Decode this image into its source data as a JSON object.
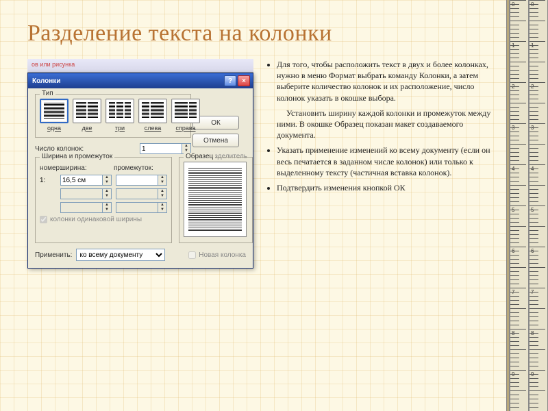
{
  "slide": {
    "title": "Разделение текста на колонки",
    "bullets": [
      "Для того, чтобы расположить текст в двух и более колонках, нужно в меню Формат выбрать команду Колонки, а затем выберите количество колонок и их расположение, число колонок указать в окошке выбора.",
      "Установить ширину каждой колонки и промежуток между ними. В окошке Образец показан макет создаваемого документа.",
      "Указать применение изменений ко всему документу (если он весь печатается в заданном числе колонок) или только к выделенному тексту (частичная вставка колонок).",
      "Подтвердить изменения кнопкой ОК"
    ],
    "toolbar_hint": "ов или рисунка"
  },
  "dialog": {
    "title": "Колонки",
    "buttons": {
      "ok": "ОК",
      "cancel": "Отмена"
    },
    "type": {
      "label": "Тип",
      "opts": [
        "одна",
        "две",
        "три",
        "слева",
        "справа"
      ],
      "selected": 0
    },
    "numcols": {
      "label": "Число колонок:",
      "value": "1"
    },
    "separator": {
      "label": "Разделитель",
      "checked": false
    },
    "width_group": {
      "label": "Ширина и промежуток",
      "cols": {
        "num": "номер:",
        "width": "ширина:",
        "gap": "промежуток:"
      },
      "rows": [
        {
          "n": "1:",
          "w": "16,5 см",
          "g": ""
        }
      ],
      "equal": {
        "label": "колонки одинаковой ширины",
        "checked": true
      }
    },
    "sample": {
      "label": "Образец"
    },
    "apply": {
      "label": "Применить:",
      "value": "ко всему документу",
      "newcol_label": "Новая колонка",
      "newcol_checked": false
    }
  }
}
